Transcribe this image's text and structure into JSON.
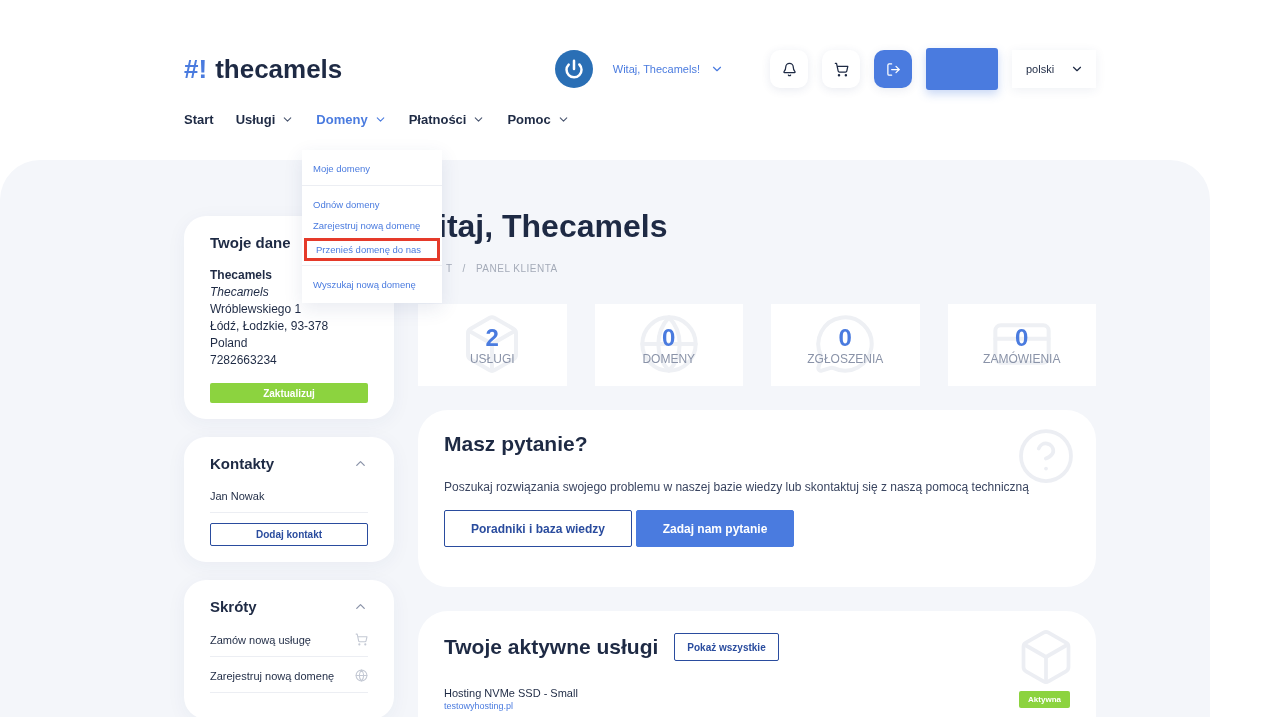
{
  "logo": {
    "mark": "#!",
    "name": "thecamels"
  },
  "header": {
    "greeting": "Witaj, Thecamels!",
    "language": "polski"
  },
  "nav": [
    {
      "label": "Start",
      "selected": false,
      "dropdown": false
    },
    {
      "label": "Usługi",
      "selected": false,
      "dropdown": true
    },
    {
      "label": "Domeny",
      "selected": true,
      "dropdown": true
    },
    {
      "label": "Płatności",
      "selected": false,
      "dropdown": true
    },
    {
      "label": "Pomoc",
      "selected": false,
      "dropdown": true
    }
  ],
  "dropdown_groups": [
    [
      {
        "label": "Moje domeny",
        "highlighted": false
      }
    ],
    [
      {
        "label": "Odnów domeny",
        "highlighted": false
      },
      {
        "label": "Zarejestruj nową domenę",
        "highlighted": false
      },
      {
        "label": "Przenieś domenę do nas",
        "highlighted": true
      }
    ],
    [
      {
        "label": "Wyszukaj nową domenę",
        "highlighted": false
      }
    ]
  ],
  "profile": {
    "title": "Twoje dane",
    "name": "Thecamels",
    "company": "Thecamels",
    "lines": [
      "Wróblewskiego 1",
      "Łódź, Łodzkie, 93-378",
      "Poland",
      "7282663234"
    ],
    "button": "Zaktualizuj"
  },
  "contacts": {
    "title": "Kontakty",
    "expanded": true,
    "items": [
      "Jan Nowak"
    ],
    "button": "Dodaj kontakt"
  },
  "shortcuts": {
    "title": "Skróty",
    "expanded": true,
    "items": [
      "Zamów nową usługę",
      "Zarejestruj nową domenę"
    ]
  },
  "page_title": "itaj, Thecamels",
  "breadcrumb": {
    "items": [
      "T",
      "PANEL KLIENTA"
    ],
    "separator": "/"
  },
  "stats": [
    {
      "value": "2",
      "label": "USŁUGI"
    },
    {
      "value": "0",
      "label": "DOMENY"
    },
    {
      "value": "0",
      "label": "ZGŁOSZENIA"
    },
    {
      "value": "0",
      "label": "ZAMÓWIENIA"
    }
  ],
  "question": {
    "title": "Masz pytanie?",
    "text": "Poszukaj rozwiązania swojego problemu w naszej bazie wiedzy lub skontaktuj się z naszą pomocą techniczną",
    "buttons": [
      {
        "label": "Poradniki i baza wiedzy",
        "kind": "outline"
      },
      {
        "label": "Zadaj nam pytanie",
        "kind": "primary"
      }
    ]
  },
  "services": {
    "title": "Twoje aktywne usługi",
    "button": "Pokaż wszystkie",
    "rows": [
      {
        "name": "Hosting NVMe SSD - Small",
        "domain": "testowyhosting.pl",
        "status": "Aktywna"
      }
    ]
  }
}
